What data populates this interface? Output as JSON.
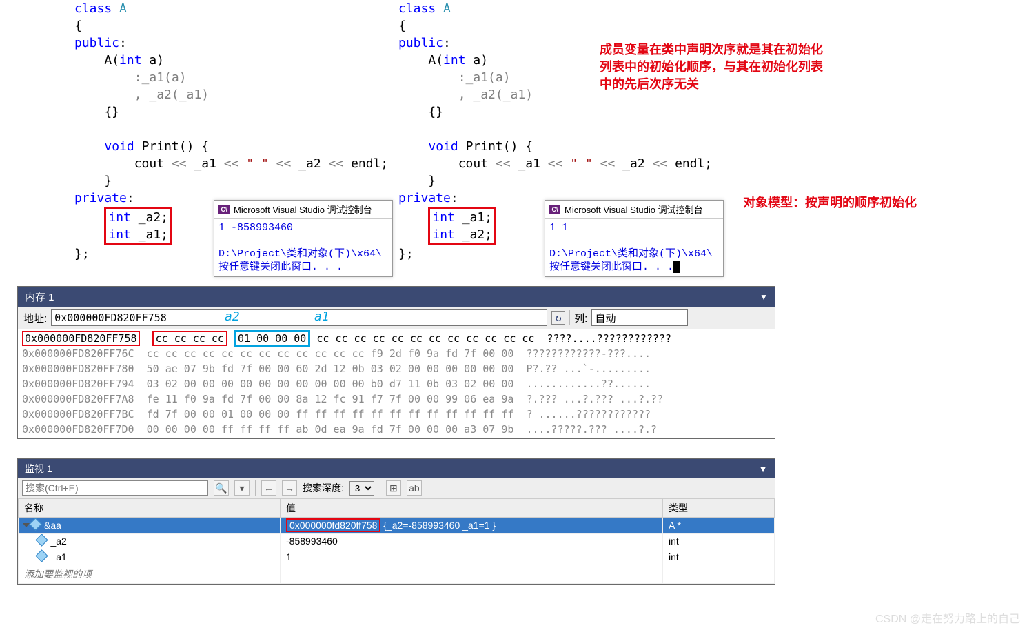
{
  "code_left": {
    "keyword_class": "class",
    "cls": "A",
    "kw_public": "public",
    "ctor": "A",
    "ctor_arg": "int a",
    "init1": ":_a1(a)",
    "init2": ", _a2(_a1)",
    "fn": "void",
    "fn_name": "Print",
    "cout": "cout ",
    "op": "<<",
    "a1": " _a1 ",
    "space_literal": "\" \"",
    "a2": " _a2 ",
    "endl": "endl;",
    "kw_private": "private",
    "decl1": "int _a2;",
    "decl2": "int _a1;"
  },
  "code_right": {
    "keyword_class": "class",
    "cls": "A",
    "kw_public": "public",
    "ctor": "A",
    "ctor_arg": "int a",
    "init1": ":_a1(a)",
    "init2": ", _a2(_a1)",
    "fn": "void",
    "fn_name": "Print",
    "cout": "cout ",
    "op": "<<",
    "a1": " _a1 ",
    "space_literal": "\" \"",
    "a2": " _a2 ",
    "endl": "endl;",
    "kw_private": "private",
    "decl1": "int _a1;",
    "decl2": "int _a2;"
  },
  "red_note_1": "成员变量在类中声明次序就是其在初始化列表中的初始化顺序，与其在初始化列表中的先后次序无关",
  "red_note_2": "对象模型：按声明的顺序初始化",
  "console_left": {
    "title": "Microsoft Visual Studio 调试控制台",
    "output": "1 -858993460",
    "path": "D:\\Project\\类和对象(下)\\x64\\",
    "hint": "按任意键关闭此窗口. . ."
  },
  "console_right": {
    "title": "Microsoft Visual Studio 调试控制台",
    "output": "1 1",
    "path": "D:\\Project\\类和对象(下)\\x64\\",
    "hint": "按任意键关闭此窗口. . ."
  },
  "memory": {
    "title": "内存 1",
    "addr_label": "地址:",
    "addr_value": "0x000000FD820FF758",
    "a2_label": "a2",
    "a1_label": "a1",
    "col_label": "列:",
    "col_value": "自动",
    "rows": [
      {
        "addr": "0x000000FD820FF758",
        "hl_addr": true,
        "bytes_pre": "cc cc cc cc",
        "bytes_mid": "01 00 00 00",
        "bytes_post": "cc cc cc cc cc cc cc cc cc cc cc cc",
        "ascii": "????....????????????"
      },
      {
        "addr": "0x000000FD820FF76C",
        "bytes": "cc cc cc cc cc cc cc cc cc cc cc cc f9 2d f0 9a fd 7f 00 00",
        "ascii": "????????????-???...."
      },
      {
        "addr": "0x000000FD820FF780",
        "bytes": "50 ae 07 9b fd 7f 00 00 60 2d 12 0b 03 02 00 00 00 00 00 00",
        "ascii": "P?.?? ...`-........."
      },
      {
        "addr": "0x000000FD820FF794",
        "bytes": "03 02 00 00 00 00 00 00 00 00 00 00 b0 d7 11 0b 03 02 00 00",
        "ascii": "............??......"
      },
      {
        "addr": "0x000000FD820FF7A8",
        "bytes": "fe 11 f0 9a fd 7f 00 00 8a 12 fc 91 f7 7f 00 00 99 06 ea 9a",
        "ascii": "?.??? ...?.??? ...?.??"
      },
      {
        "addr": "0x000000FD820FF7BC",
        "bytes": "fd 7f 00 00 01 00 00 00 ff ff ff ff ff ff ff ff ff ff ff ff",
        "ascii": "? ......????????????"
      },
      {
        "addr": "0x000000FD820FF7D0",
        "bytes": "00 00 00 00 ff ff ff ff ab 0d ea 9a fd 7f 00 00 00 a3 07 9b",
        "ascii": "....?????.??? ....?.?"
      }
    ]
  },
  "watch": {
    "title": "监视 1",
    "search_placeholder": "搜索(Ctrl+E)",
    "depth_label": "搜索深度:",
    "depth_value": "3",
    "cols": {
      "name": "名称",
      "value": "值",
      "type": "类型"
    },
    "rows": [
      {
        "name": "&aa",
        "value_addr": "0x000000fd820ff758",
        "value_rest": " {_a2=-858993460 _a1=1 }",
        "type": "A *",
        "selected": true
      },
      {
        "name": "_a2",
        "value": "-858993460",
        "type": "int"
      },
      {
        "name": "_a1",
        "value": "1",
        "type": "int"
      }
    ],
    "placeholder": "添加要监视的项"
  },
  "watermark": "CSDN @走在努力路上的自己"
}
